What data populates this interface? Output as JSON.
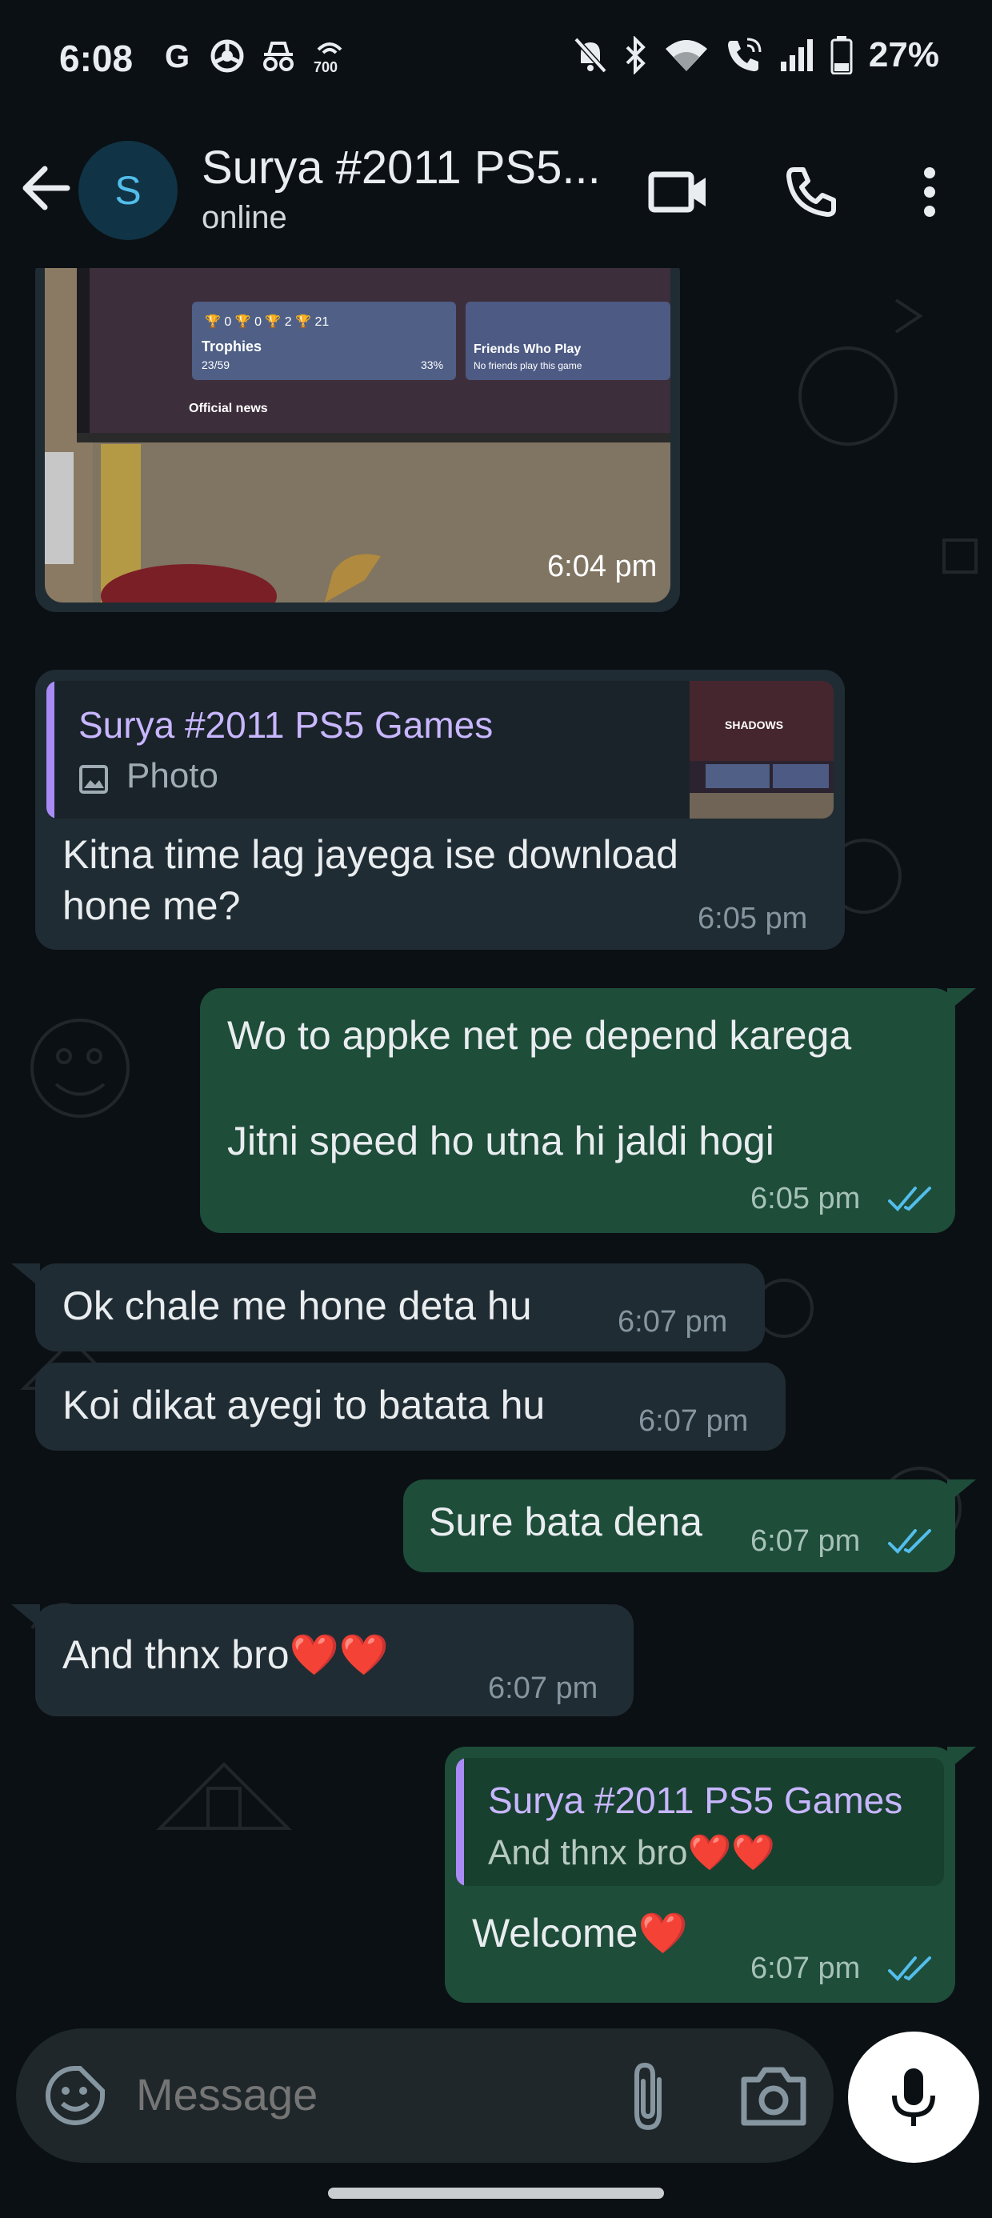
{
  "status_bar": {
    "time": "6:08",
    "left_icons": [
      "google-icon",
      "chrome-icon",
      "incognito-icon",
      "hotspot-700-icon"
    ],
    "battery_percent": "27%",
    "right_icons": [
      "do-not-disturb-icon",
      "bluetooth-icon",
      "wifi-icon",
      "wifi-calling-icon",
      "signal-icon",
      "battery-icon"
    ]
  },
  "header": {
    "avatar_letter": "S",
    "contact_name": "Surya #2011 PS5...",
    "status": "online",
    "actions": [
      "video-call-icon",
      "voice-call-icon",
      "more-options-icon"
    ]
  },
  "messages": [
    {
      "id": "m1",
      "direction": "in",
      "type": "image",
      "time": "6:04 pm",
      "image_text": {
        "trophies_label": "Trophies",
        "trophies_progress": "23/59",
        "trophies_percent": "33%",
        "counts": [
          "0",
          "0",
          "2",
          "21"
        ],
        "friends_title": "Friends Who Play",
        "friends_sub": "No friends play this game",
        "news": "Official news"
      }
    },
    {
      "id": "m2",
      "direction": "in",
      "type": "reply",
      "reply_to_name": "Surya #2011 PS5 Games",
      "reply_to_text": "Photo",
      "reply_thumb_text": "SHADOWS",
      "text_lines": [
        "Kitna time lag jayega ise download",
        "hone me?"
      ],
      "time": "6:05 pm"
    },
    {
      "id": "m3",
      "direction": "out",
      "type": "text",
      "text_lines": [
        "Wo to appke net pe depend karega",
        "",
        "Jitni speed ho utna hi jaldi hogi"
      ],
      "time": "6:05 pm",
      "read": true
    },
    {
      "id": "m4",
      "direction": "in",
      "type": "text",
      "text": "Ok chale me hone deta hu",
      "time": "6:07 pm"
    },
    {
      "id": "m5",
      "direction": "in",
      "type": "text",
      "text": "Koi dikat ayegi to batata hu",
      "time": "6:07 pm"
    },
    {
      "id": "m6",
      "direction": "out",
      "type": "text",
      "text": "Sure bata dena",
      "time": "6:07 pm",
      "read": true
    },
    {
      "id": "m7",
      "direction": "in",
      "type": "text",
      "text": "And thnx bro❤️❤️",
      "time": "6:07 pm"
    },
    {
      "id": "m8",
      "direction": "out",
      "type": "reply",
      "reply_to_name": "Surya #2011 PS5 Games",
      "reply_to_text": "And thnx bro❤️❤️",
      "text": "Welcome❤️",
      "time": "6:07 pm",
      "read": true
    }
  ],
  "composer": {
    "placeholder": "Message",
    "icons": [
      "emoji-sticker-icon",
      "attach-icon",
      "camera-icon",
      "microphone-icon"
    ]
  },
  "colors": {
    "background": "#0b1014",
    "incoming_bubble": "#202c33",
    "outgoing_bubble": "#1e4d3a",
    "read_tick": "#53bdeb",
    "reply_accent": "#a98bf5"
  }
}
